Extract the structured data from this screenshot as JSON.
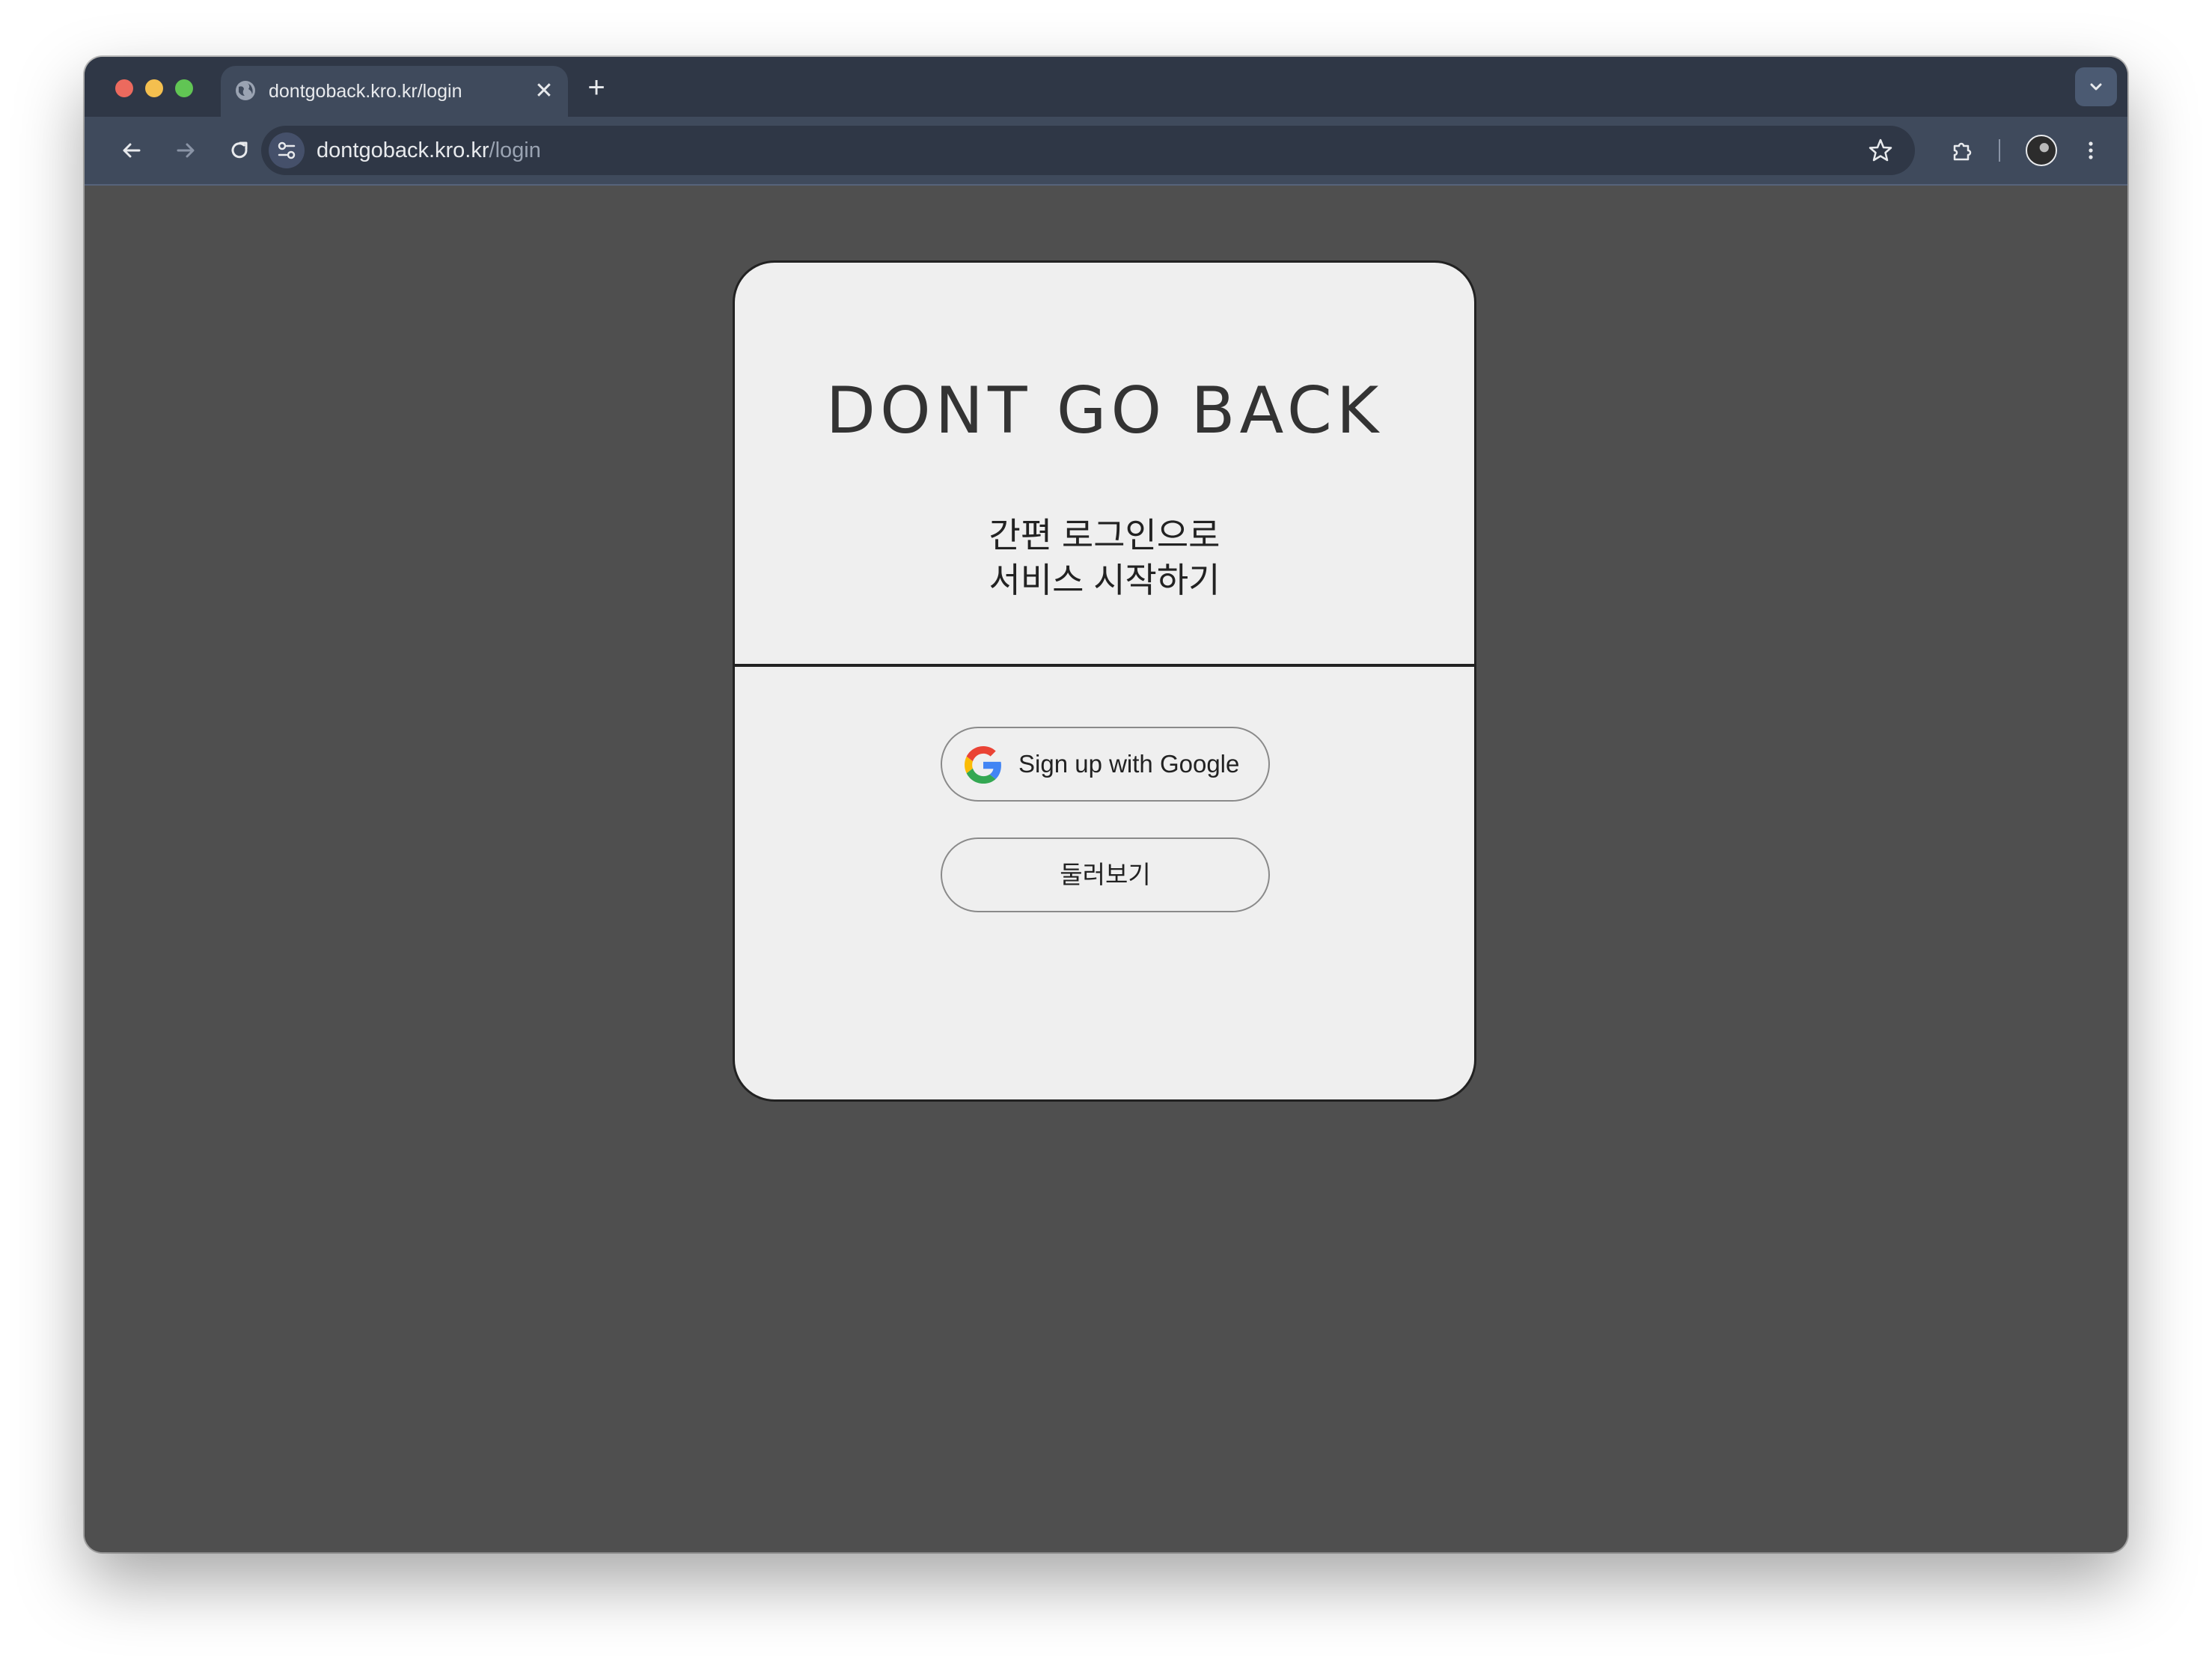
{
  "browser": {
    "tab": {
      "title": "dontgoback.kro.kr/login",
      "favicon": "globe-icon",
      "close_icon": "close-icon"
    },
    "new_tab_icon": "plus-icon",
    "tab_search_icon": "chevron-down-icon",
    "toolbar": {
      "back_icon": "arrow-left-icon",
      "forward_icon": "arrow-right-icon",
      "reload_icon": "reload-icon",
      "site_info_icon": "tune-icon",
      "url_host": "dontgoback.kro.kr",
      "url_path": "/login",
      "bookmark_icon": "star-icon",
      "extensions_icon": "puzzle-icon",
      "profile_icon": "avatar",
      "menu_icon": "more-vert-icon"
    }
  },
  "login_card": {
    "title": "DONT GO BACK",
    "subtitle_line1": "간편 로그인으로",
    "subtitle_line2": "서비스 시작하기",
    "google_button_label": "Sign up with Google",
    "browse_button_label": "둘러보기"
  },
  "colors": {
    "page_background": "#4f4f4f",
    "card_background": "#efefef",
    "card_border": "#222222",
    "tab_strip": "#2f3746",
    "toolbar": "#3f4a5c"
  }
}
